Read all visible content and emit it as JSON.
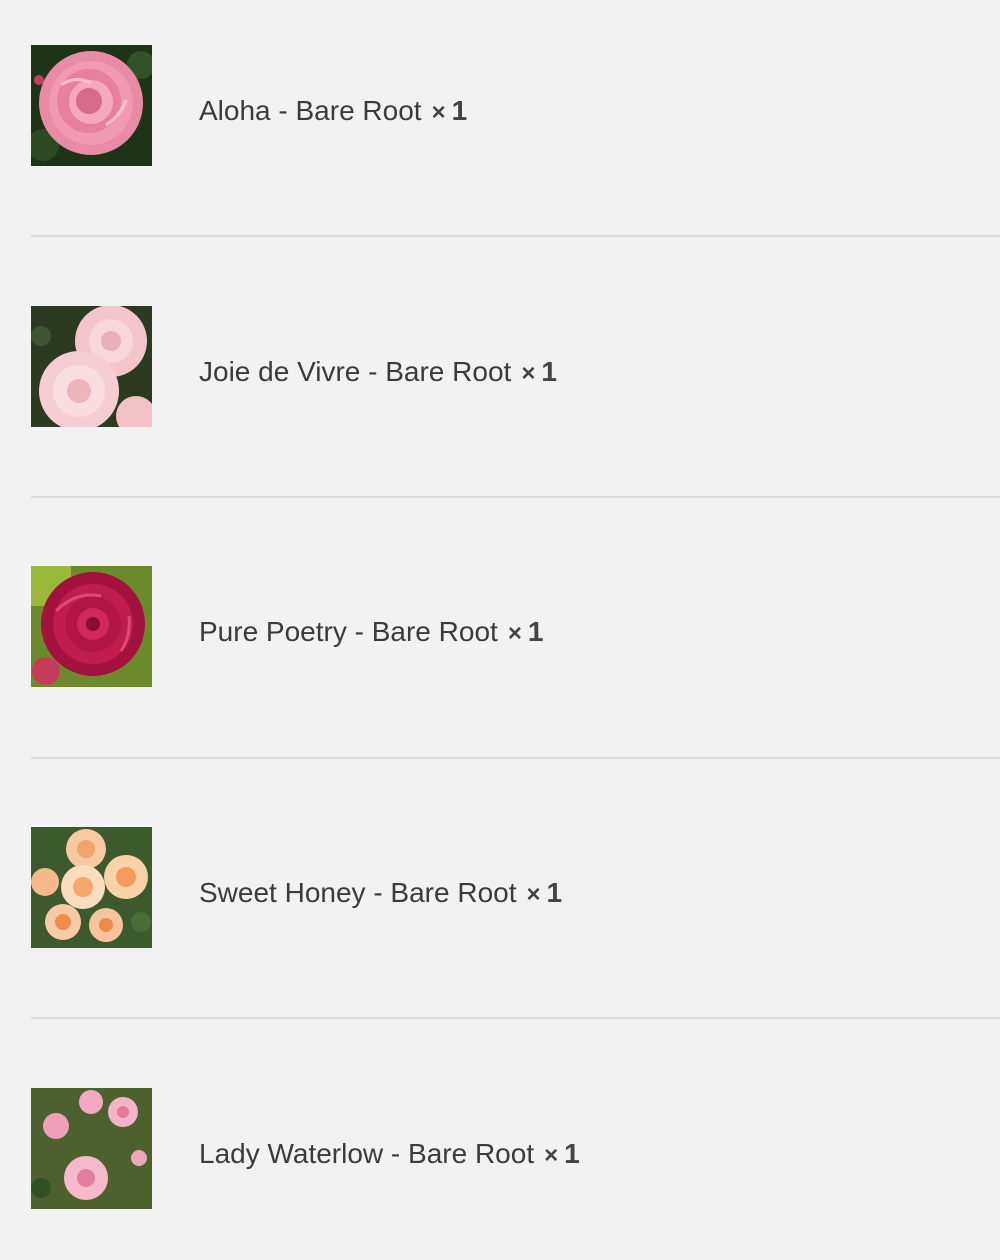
{
  "items": [
    {
      "name": "Aloha - Bare Root",
      "times": "×",
      "qty": "1",
      "thumbnail": "pink-rose-thumbnail"
    },
    {
      "name": "Joie de Vivre - Bare Root",
      "times": "×",
      "qty": "1",
      "thumbnail": "pale-pink-rose-thumbnail"
    },
    {
      "name": "Pure Poetry - Bare Root",
      "times": "×",
      "qty": "1",
      "thumbnail": "crimson-rose-thumbnail"
    },
    {
      "name": "Sweet Honey - Bare Root",
      "times": "×",
      "qty": "1",
      "thumbnail": "apricot-rose-thumbnail"
    },
    {
      "name": "Lady Waterlow - Bare Root",
      "times": "×",
      "qty": "1",
      "thumbnail": "climbing-pink-rose-thumbnail"
    }
  ],
  "colors": {
    "background": "#f2f2f2",
    "text": "#3b3b3b",
    "divider": "#dcdcdc"
  }
}
